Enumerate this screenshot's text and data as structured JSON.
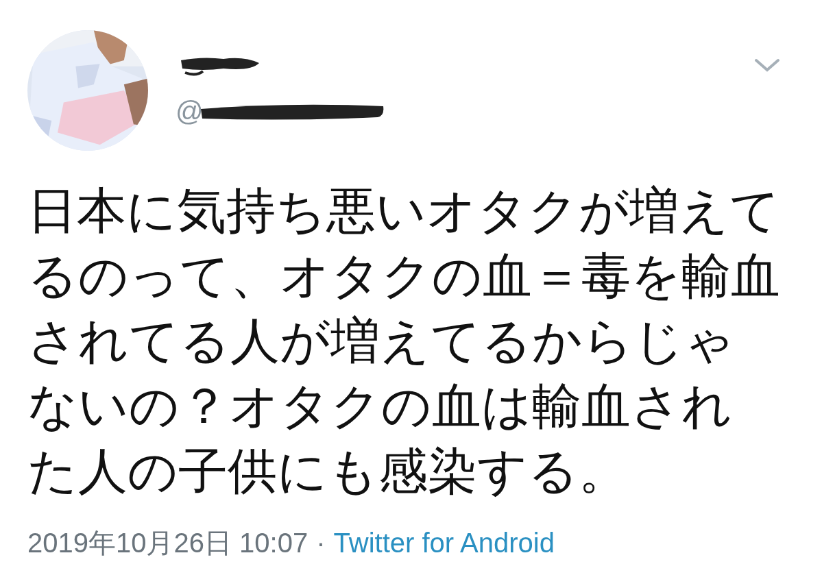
{
  "tweet": {
    "handle_prefix": "@",
    "text": "日本に気持ち悪いオタクが増えてるのって、オタクの血＝毒を輸血されてる人が増えてるからじゃないの？オタクの血は輸血された人の子供にも感染する。",
    "timestamp": "2019年10月26日 10:07",
    "separator": "·",
    "source": "Twitter for Android"
  }
}
